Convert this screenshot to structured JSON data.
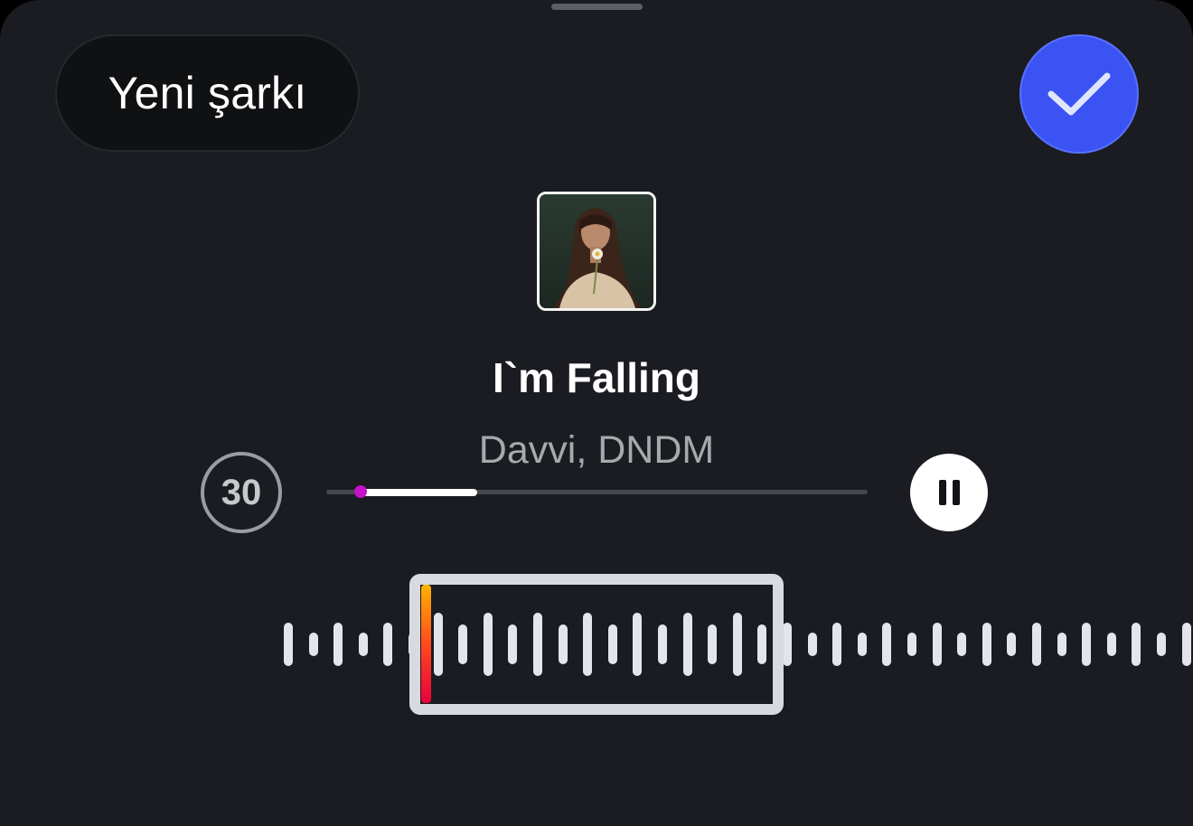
{
  "header": {
    "new_song_label": "Yeni şarkı",
    "confirm_icon": "checkmark-icon"
  },
  "track": {
    "title": "I`m Falling",
    "artist": "Davvi, DNDM",
    "cover_icon": "album-cover-image"
  },
  "player": {
    "duration_label": "30",
    "playhead_fraction": 0.06,
    "selection_start_fraction": 0.06,
    "selection_end_fraction": 0.28,
    "pause_icon": "pause-icon"
  },
  "colors": {
    "background": "#1a1c21",
    "accent_blue": "#3a53f2",
    "playhead": "#c312c8",
    "marker_top": "#ffb300",
    "marker_bottom": "#e8003b",
    "waveform": "#e4e5ea"
  }
}
